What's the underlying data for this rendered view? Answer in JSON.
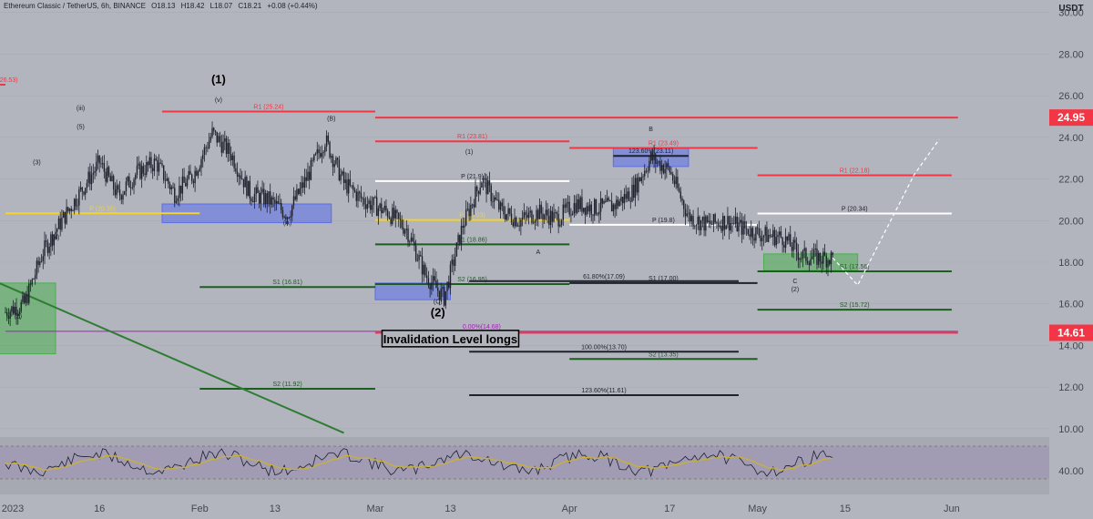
{
  "header": {
    "symbol": "Ethereum Classic / TetherUS, 6h, BINANCE",
    "open": "O18.13",
    "high": "H18.42",
    "low": "L18.07",
    "close": "C18.21",
    "change": "+0.08 (+0.44%)"
  },
  "currency": "USDT",
  "price_tags": [
    {
      "value": "24.95",
      "price": 24.95,
      "color": "#f23645"
    },
    {
      "value": "14.61",
      "price": 14.61,
      "color": "#f23645"
    }
  ],
  "colors": {
    "background": "#b2b5be",
    "pivot_red": "#f23645",
    "pivot_yellow": "#f5d32b",
    "pivot_white": "#ffffff",
    "support_green": "#1b5e20",
    "trendline_green": "#2e7d32",
    "box_blue": "#5b6ee8",
    "box_green": "#4caf50",
    "candles": "#1e222d",
    "rsi_line": "#1e222d",
    "rsi_ma": "#c9b03a",
    "rsi_band": "#9c8fb6"
  },
  "chart_data": {
    "type": "candlestick",
    "title": "Ethereum Classic / TetherUS, 6h, BINANCE",
    "ylabel": "USDT",
    "ylim": [
      9.6,
      30.6
    ],
    "y_ticks": [
      "10.00",
      "12.00",
      "14.00",
      "16.00",
      "18.00",
      "20.00",
      "22.00",
      "24.00",
      "26.00",
      "28.00",
      "30.00"
    ],
    "x_ticks": [
      "2023",
      "16",
      "Feb",
      "13",
      "Mar",
      "13",
      "Apr",
      "17",
      "May",
      "15",
      "Jun"
    ],
    "price_path": [
      {
        "date": "2023-01-01",
        "price": 15.6
      },
      {
        "date": "2023-01-04",
        "price": 16.0
      },
      {
        "date": "2023-01-07",
        "price": 18.5
      },
      {
        "date": "2023-01-10",
        "price": 20.0
      },
      {
        "date": "2023-01-13",
        "price": 21.4
      },
      {
        "date": "2023-01-16",
        "price": 22.8
      },
      {
        "date": "2023-01-19",
        "price": 21.2
      },
      {
        "date": "2023-01-22",
        "price": 22.3
      },
      {
        "date": "2023-01-25",
        "price": 22.8
      },
      {
        "date": "2023-01-28",
        "price": 21.3
      },
      {
        "date": "2023-01-31",
        "price": 22.2
      },
      {
        "date": "2023-02-03",
        "price": 24.2
      },
      {
        "date": "2023-02-06",
        "price": 23.2
      },
      {
        "date": "2023-02-09",
        "price": 21.3
      },
      {
        "date": "2023-02-12",
        "price": 21.0
      },
      {
        "date": "2023-02-15",
        "price": 20.3
      },
      {
        "date": "2023-02-18",
        "price": 22.0
      },
      {
        "date": "2023-02-21",
        "price": 23.9
      },
      {
        "date": "2023-02-24",
        "price": 21.8
      },
      {
        "date": "2023-02-27",
        "price": 21.0
      },
      {
        "date": "2023-03-03",
        "price": 20.4
      },
      {
        "date": "2023-03-06",
        "price": 19.6
      },
      {
        "date": "2023-03-09",
        "price": 17.4
      },
      {
        "date": "2023-03-12",
        "price": 16.3
      },
      {
        "date": "2023-03-15",
        "price": 19.8
      },
      {
        "date": "2023-03-18",
        "price": 22.0
      },
      {
        "date": "2023-03-21",
        "price": 20.5
      },
      {
        "date": "2023-03-24",
        "price": 20.0
      },
      {
        "date": "2023-03-27",
        "price": 20.4
      },
      {
        "date": "2023-03-30",
        "price": 20.1
      },
      {
        "date": "2023-04-02",
        "price": 20.8
      },
      {
        "date": "2023-04-05",
        "price": 20.6
      },
      {
        "date": "2023-04-08",
        "price": 20.7
      },
      {
        "date": "2023-04-11",
        "price": 21.4
      },
      {
        "date": "2023-04-14",
        "price": 23.0
      },
      {
        "date": "2023-04-17",
        "price": 22.4
      },
      {
        "date": "2023-04-20",
        "price": 20.2
      },
      {
        "date": "2023-04-23",
        "price": 19.8
      },
      {
        "date": "2023-04-26",
        "price": 20.0
      },
      {
        "date": "2023-04-29",
        "price": 19.6
      },
      {
        "date": "2023-05-02",
        "price": 19.3
      },
      {
        "date": "2023-05-05",
        "price": 19.2
      },
      {
        "date": "2023-05-08",
        "price": 18.3
      },
      {
        "date": "2023-05-11",
        "price": 18.2
      },
      {
        "date": "2023-05-13",
        "price": 18.21
      }
    ],
    "projection": [
      {
        "date": "2023-05-13",
        "price": 18.21
      },
      {
        "date": "2023-05-17",
        "price": 16.9
      },
      {
        "date": "2023-05-26",
        "price": 22.2
      },
      {
        "date": "2023-05-30",
        "price": 23.9
      }
    ],
    "rsi": {
      "y_ticks": [
        "40.00"
      ],
      "note": "RSI oscillating roughly between 33 and 62 over the period"
    },
    "trendline": {
      "from": {
        "date": "2022-12-31",
        "price": 17.0
      },
      "to": {
        "date": "2023-02-24",
        "price": 9.8
      }
    },
    "annotations": [
      {
        "text": "(1)",
        "date": "2023-02-04",
        "price": 26.6,
        "bold": true
      },
      {
        "text": "(v)",
        "date": "2023-02-04",
        "price": 25.7
      },
      {
        "text": "(iii)",
        "date": "2023-01-13",
        "price": 25.3
      },
      {
        "text": "(5)",
        "date": "2023-01-13",
        "price": 24.4
      },
      {
        "text": "(3)",
        "date": "2023-01-06",
        "price": 22.7
      },
      {
        "text": "(4)",
        "date": "2023-01-09",
        "price": 19.1
      },
      {
        "text": "(2)",
        "date": "2023-01-03",
        "price": 15.3
      },
      {
        "text": "(B)",
        "date": "2023-02-22",
        "price": 24.8
      },
      {
        "text": "(A)",
        "date": "2023-02-15",
        "price": 19.8
      },
      {
        "text": "(2)",
        "date": "2023-03-11",
        "price": 15.4,
        "bold": true
      },
      {
        "text": "(C)",
        "date": "2023-03-11",
        "price": 16.0
      },
      {
        "text": "(1)",
        "date": "2023-03-16",
        "price": 23.2
      },
      {
        "text": "A",
        "date": "2023-03-27",
        "price": 18.4
      },
      {
        "text": "B",
        "date": "2023-04-14",
        "price": 24.3
      },
      {
        "text": "C",
        "date": "2023-05-07",
        "price": 17.0
      },
      {
        "text": "(2)",
        "date": "2023-05-07",
        "price": 16.6
      }
    ],
    "levels": [
      {
        "label": "R1 (25.24)",
        "price": 25.24,
        "from": "2023-01-26",
        "to": "2023-03-01",
        "color": "red"
      },
      {
        "label": "R1 (23.81)",
        "price": 23.81,
        "from": "2023-03-01",
        "to": "2023-04-01",
        "color": "red"
      },
      {
        "label": "R1 (23.49)",
        "price": 23.49,
        "from": "2023-04-01",
        "to": "2023-05-01",
        "color": "red"
      },
      {
        "label": "R1 (22.18)",
        "price": 22.18,
        "from": "2023-05-01",
        "to": "2023-06-01",
        "color": "red"
      },
      {
        "label": "R1 (26.53)",
        "price": 26.53,
        "from": "2022-12-31",
        "to": "2023-01-01",
        "color": "red"
      },
      {
        "label": "P (20.35)",
        "price": 20.35,
        "from": "2023-01-01",
        "to": "2023-02-01",
        "color": "yellow"
      },
      {
        "label": "P (20.03)",
        "price": 20.03,
        "from": "2023-03-01",
        "to": "2023-04-01",
        "color": "yellow"
      },
      {
        "label": "P (20.34)",
        "price": 20.34,
        "from": "2023-05-01",
        "to": "2023-06-01",
        "color": "white"
      },
      {
        "label": "P (21.9)",
        "price": 21.9,
        "from": "2023-03-01",
        "to": "2023-04-01",
        "color": "white"
      },
      {
        "label": "P (19.8)",
        "price": 19.8,
        "from": "2023-04-01",
        "to": "2023-05-01",
        "color": "white"
      },
      {
        "label": "S1 (18.86)",
        "price": 18.86,
        "from": "2023-03-01",
        "to": "2023-04-01",
        "color": "green"
      },
      {
        "label": "S1 (16.81)",
        "price": 16.81,
        "from": "2023-02-01",
        "to": "2023-03-01",
        "color": "green"
      },
      {
        "label": "S1 (17.56)",
        "price": 17.56,
        "from": "2023-05-01",
        "to": "2023-06-01",
        "color": "green"
      },
      {
        "label": "S1 (17.00)",
        "price": 17.0,
        "from": "2023-04-01",
        "to": "2023-05-01",
        "color": "black"
      },
      {
        "label": "S2 (16.95)",
        "price": 16.95,
        "from": "2023-03-01",
        "to": "2023-04-01",
        "color": "green"
      },
      {
        "label": "S2 (15.72)",
        "price": 15.72,
        "from": "2023-05-01",
        "to": "2023-06-01",
        "color": "green"
      },
      {
        "label": "S2 (13.35)",
        "price": 13.35,
        "from": "2023-04-01",
        "to": "2023-05-01",
        "color": "green"
      },
      {
        "label": "S2 (11.92)",
        "price": 11.92,
        "from": "2023-02-01",
        "to": "2023-03-01",
        "color": "green"
      },
      {
        "label": "61.80%(17.09)",
        "price": 17.09,
        "from": "2023-03-16",
        "to": "2023-04-28",
        "color": "black"
      },
      {
        "label": "100.00%(13.70)",
        "price": 13.7,
        "from": "2023-03-16",
        "to": "2023-04-28",
        "color": "black"
      },
      {
        "label": "123.60%(11.61)",
        "price": 11.61,
        "from": "2023-03-16",
        "to": "2023-04-28",
        "color": "black"
      },
      {
        "label": "123.60%(23.11)",
        "price": 23.11,
        "from": "2023-04-08",
        "to": "2023-04-20",
        "color": "black"
      },
      {
        "label": "0.00%(14.68)",
        "price": 14.68,
        "from": "2023-01-01",
        "to": "2023-06-02",
        "color": "purple"
      },
      {
        "label": "",
        "price": 24.95,
        "from": "2023-03-01",
        "to": "2023-06-02",
        "color": "red"
      },
      {
        "label": "",
        "price": 14.61,
        "from": "2023-03-01",
        "to": "2023-06-02",
        "color": "red"
      }
    ],
    "boxes": [
      {
        "from": "2023-01-26",
        "to": "2023-02-22",
        "top": 20.8,
        "bottom": 19.9,
        "color": "blue"
      },
      {
        "from": "2023-03-01",
        "to": "2023-03-13",
        "top": 17.0,
        "bottom": 16.2,
        "color": "blue"
      },
      {
        "from": "2023-04-08",
        "to": "2023-04-20",
        "top": 23.5,
        "bottom": 22.6,
        "color": "blue"
      },
      {
        "from": "2022-12-31",
        "to": "2023-01-09",
        "top": 17.0,
        "bottom": 13.6,
        "color": "green"
      },
      {
        "from": "2023-05-02",
        "to": "2023-05-17",
        "top": 18.4,
        "bottom": 17.6,
        "color": "green"
      }
    ],
    "callout": {
      "text": "Invalidation Level longs",
      "date": "2023-03-13",
      "price": 14.2
    }
  }
}
